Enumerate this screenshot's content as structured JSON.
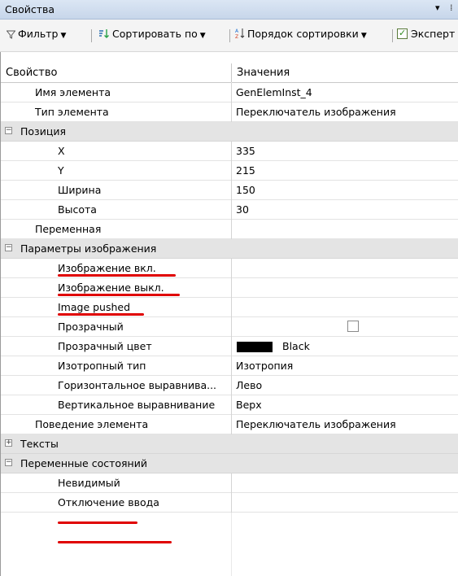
{
  "panel": {
    "title": "Свойства",
    "pin_glyph": "▾",
    "extra_glyph": "⁞"
  },
  "toolbar": {
    "filter_label": "Фильтр",
    "sort_by_label": "Сортировать по",
    "sort_order_label": "Порядок сортировки",
    "expert_label": "Эксперт",
    "expert_checked": true
  },
  "header": {
    "property": "Свойство",
    "values": "Значения"
  },
  "rows": [
    {
      "name": "Имя элемента",
      "value": "GenElemInst_4"
    },
    {
      "name": "Тип элемента",
      "value": "Переключатель изображения"
    },
    {
      "name": "Позиция",
      "expander": "⊟"
    },
    {
      "name": "X",
      "value": "335"
    },
    {
      "name": "Y",
      "value": "215"
    },
    {
      "name": "Ширина",
      "value": "150"
    },
    {
      "name": "Высота",
      "value": "30"
    },
    {
      "name": "Переменная",
      "value": ""
    },
    {
      "name": "Параметры изображения",
      "expander": "⊟"
    },
    {
      "name": "Изображение вкл.",
      "value": ""
    },
    {
      "name": "Изображение выкл.",
      "value": ""
    },
    {
      "name": "Image pushed",
      "value": ""
    },
    {
      "name": "Прозрачный",
      "checked": false
    },
    {
      "name": "Прозрачный цвет",
      "value": "Black",
      "swatch": "#000000"
    },
    {
      "name": "Изотропный тип",
      "value": "Изотропия"
    },
    {
      "name": "Горизонтальное выравнива...",
      "value": "Лево"
    },
    {
      "name": "Вертикальное выравнивание",
      "value": "Верх"
    },
    {
      "name": "Поведение элемента",
      "value": "Переключатель изображения"
    },
    {
      "name": "Тексты",
      "expander": "⊞"
    },
    {
      "name": "Переменные состояний",
      "expander": "⊟"
    },
    {
      "name": "Невидимый",
      "value": ""
    },
    {
      "name": "Отключение ввода",
      "value": ""
    }
  ],
  "colors": {
    "annotation": "#e00000",
    "category_bg": "#e4e4e4",
    "titlebar": "#c7d6ea"
  }
}
